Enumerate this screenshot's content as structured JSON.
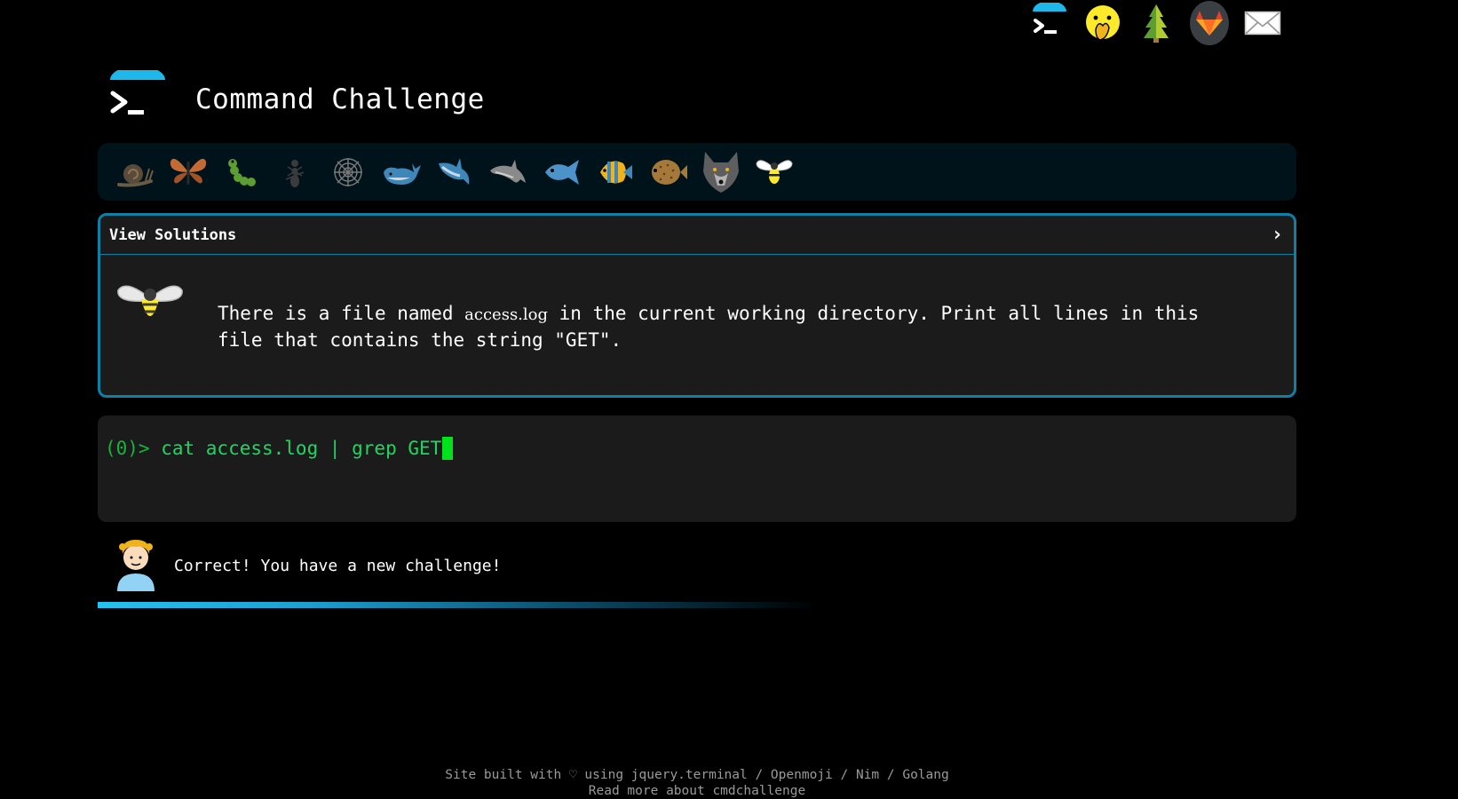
{
  "top_icons": [
    {
      "name": "terminal-icon"
    },
    {
      "name": "face-with-hand-over-mouth-icon"
    },
    {
      "name": "tree-icon"
    },
    {
      "name": "gitlab-icon"
    },
    {
      "name": "envelope-icon"
    }
  ],
  "header": {
    "title": "Command Challenge"
  },
  "levels": [
    "snail-icon",
    "butterfly-icon",
    "caterpillar-icon",
    "ant-icon",
    "spider-web-icon",
    "whale-icon",
    "shark-icon",
    "dolphin-icon",
    "fish-icon",
    "tropical-fish-icon",
    "blowfish-icon",
    "wolf-icon",
    "bee-icon"
  ],
  "challenge": {
    "head_label": "View Solutions",
    "chevron": "›",
    "text_before": "There is a file named ",
    "text_code": "access.log",
    "text_after": " in the current working directory. Print all lines in this file that contains the string \"GET\"."
  },
  "terminal": {
    "prompt": "(0)> ",
    "command": "cat access.log | grep GET"
  },
  "result": {
    "message": "Correct! You have a new challenge!"
  },
  "progress": {
    "percent": 60
  },
  "footer": {
    "line1_pre": "Site built with ",
    "heart": "♡",
    "line1_post": " using jquery.terminal / Openmoji / Nim / Golang",
    "line2": "Read more about cmdchallenge"
  },
  "colors": {
    "accent": "#0e7fa5",
    "terminal_green": "#1ed760",
    "panel_bg": "#1b1b1b",
    "levelbar_bg": "#00131b"
  }
}
